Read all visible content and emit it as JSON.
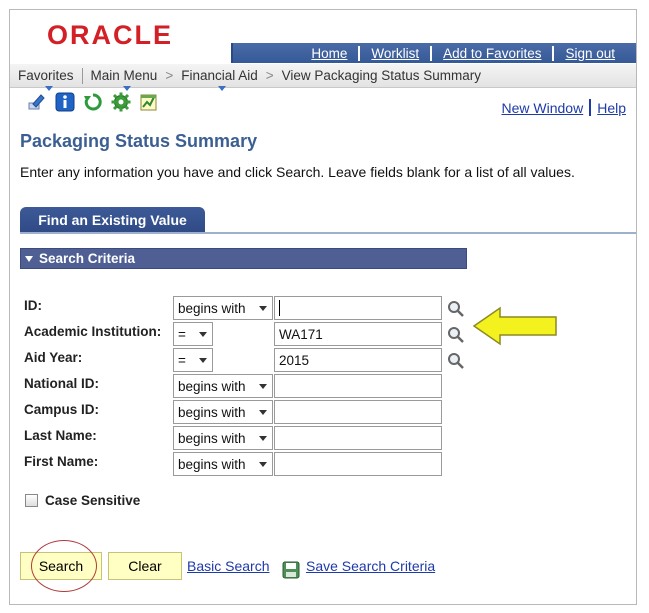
{
  "header": {
    "logo": "ORACLE",
    "links": [
      "Home",
      "Worklist",
      "Add to Favorites",
      "Sign out"
    ]
  },
  "breadcrumb": {
    "favorites": "Favorites",
    "main_menu": "Main Menu",
    "financial_aid": "Financial Aid",
    "current": "View Packaging Status Summary",
    "separator": ">"
  },
  "toolbar": {
    "icons": [
      "edit-icon",
      "info-icon",
      "refresh-icon",
      "settings-icon",
      "chart-icon"
    ]
  },
  "top_links": {
    "new_window": "New Window",
    "help": "Help"
  },
  "page": {
    "title": "Packaging Status Summary",
    "instructions": "Enter any information you have and click Search. Leave fields blank for a list of all values."
  },
  "tab": {
    "label": "Find an Existing Value"
  },
  "criteria": {
    "header": "Search Criteria",
    "fields": [
      {
        "label": "ID:",
        "operator": "begins with",
        "value": ""
      },
      {
        "label": "Academic Institution:",
        "operator": "=",
        "value": "WA171"
      },
      {
        "label": "Aid Year:",
        "operator": "=",
        "value": "2015"
      },
      {
        "label": "National ID:",
        "operator": "begins with",
        "value": ""
      },
      {
        "label": "Campus ID:",
        "operator": "begins with",
        "value": ""
      },
      {
        "label": "Last Name:",
        "operator": "begins with",
        "value": ""
      },
      {
        "label": "First Name:",
        "operator": "begins with",
        "value": ""
      }
    ],
    "case_sensitive": "Case Sensitive"
  },
  "actions": {
    "search": "Search",
    "clear": "Clear",
    "basic_search": "Basic Search",
    "save_search": "Save Search Criteria"
  },
  "colors": {
    "brand_red": "#d31f26",
    "header_blue": "#365a98",
    "title_blue": "#3c5f93",
    "link_blue": "#1f3aa9",
    "button_yellow": "#ffffc3",
    "arrow_yellow": "#f4f21e"
  }
}
